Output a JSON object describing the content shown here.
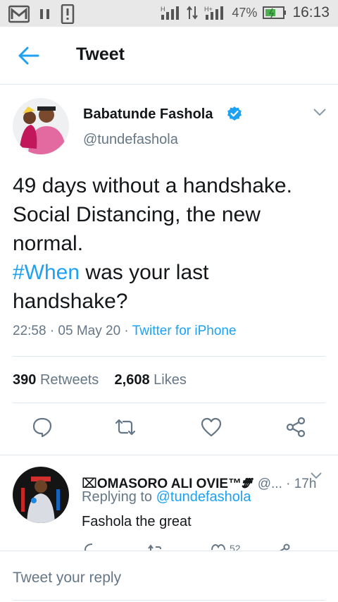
{
  "status_bar": {
    "battery_percent": "47%",
    "time": "16:13",
    "network_label": "H",
    "network_label_2": "H+"
  },
  "header": {
    "title": "Tweet",
    "back_icon": "arrow-left-icon"
  },
  "tweet": {
    "author_name": "Babatunde Fashola",
    "author_handle": "@tundefashola",
    "text_line1": "49 days without a handshake.",
    "text_line2": "Social Distancing, the new",
    "text_line3": "normal.",
    "hashtag": "#When",
    "text_after_hashtag": " was your last",
    "text_line5": "handshake?",
    "timestamp": "22:58 · 05 May 20 · ",
    "source": "Twitter for iPhone",
    "retweets_count": "390",
    "retweets_label": "Retweets",
    "likes_count": "2,608",
    "likes_label": "Likes"
  },
  "reply": {
    "author_name": "⌧OMASORO ALI OVIE™🝝",
    "author_handle": " @...",
    "time": " · 17h",
    "replying_prefix": "Replying to ",
    "replying_to": "@tundefashola",
    "text": "Fashola the great",
    "likes_count": "52"
  },
  "compose": {
    "placeholder": "Tweet your reply"
  },
  "colors": {
    "accent": "#1da1f2",
    "text": "#14171a",
    "secondary": "#657786",
    "divider": "#e1e8ed",
    "status_bar_bg": "#e8e8e8"
  }
}
